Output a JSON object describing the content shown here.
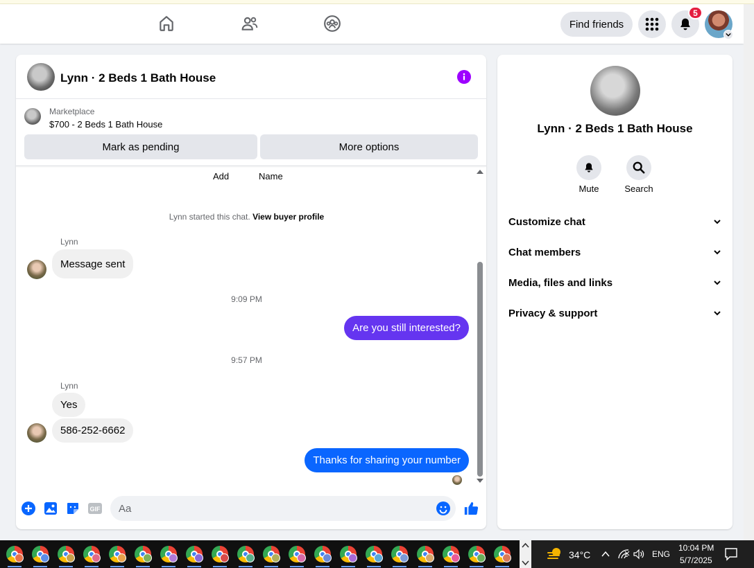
{
  "topbar": {
    "nav": [
      {
        "name": "home-icon"
      },
      {
        "name": "friends-icon"
      },
      {
        "name": "groups-icon"
      }
    ],
    "find_friends_label": "Find friends",
    "notification_count": "5"
  },
  "chat": {
    "title": "Lynn · 2 Beds 1 Bath House",
    "marketplace_label": "Marketplace",
    "listing": "$700 - 2 Beds 1 Bath House",
    "mark_pending_label": "Mark as pending",
    "more_options_label": "More options",
    "add_label": "Add",
    "name_label": "Name",
    "started_text": "Lynn started this chat.",
    "view_profile_label": "View buyer profile",
    "messages": [
      {
        "sender": "Lynn",
        "text": "Message sent"
      },
      {
        "time": "9:09 PM"
      },
      {
        "text": "Are you still interested?"
      },
      {
        "time": "9:57 PM"
      },
      {
        "sender": "Lynn",
        "text": "Yes"
      },
      {
        "text": "586-252-6662"
      },
      {
        "text": "Thanks for sharing your number"
      }
    ],
    "input_placeholder": "Aa",
    "colors": {
      "purple_bubble": "#6535f0",
      "blue_bubble": "#0a66ff",
      "accent": "#0866ff"
    }
  },
  "info": {
    "title": "Lynn · 2 Beds 1 Bath House",
    "mute_label": "Mute",
    "search_label": "Search",
    "sections": [
      "Customize chat",
      "Chat members",
      "Media, files and links",
      "Privacy & support"
    ]
  },
  "taskbar": {
    "temperature": "34°C",
    "language": "ENG",
    "time": "10:04 PM",
    "date": "5/7/2025"
  }
}
